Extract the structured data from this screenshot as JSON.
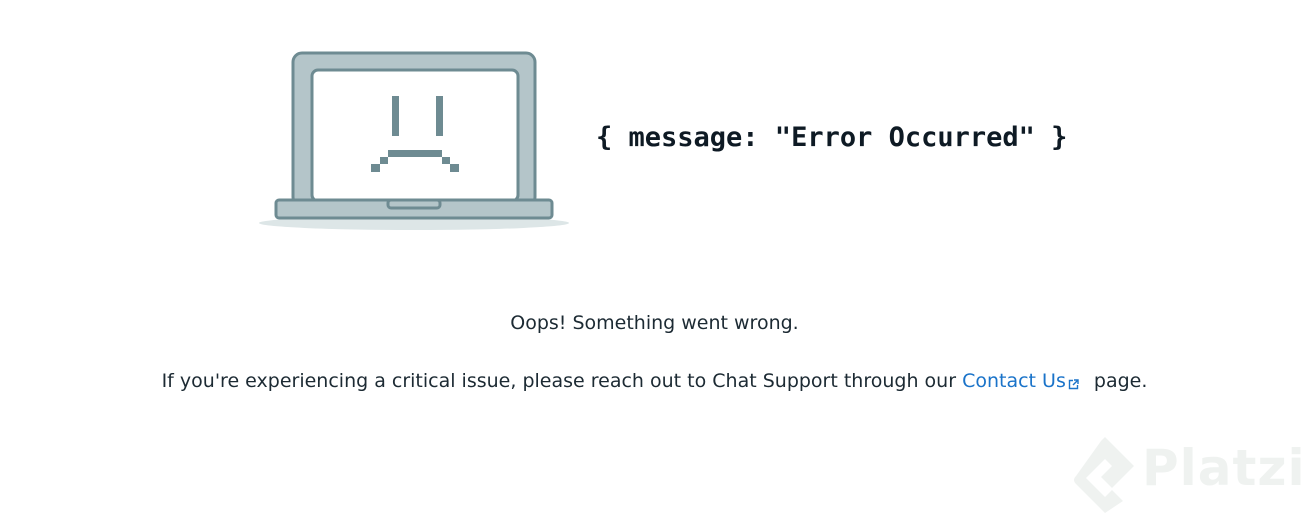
{
  "illustration": {
    "icon": "sad-laptop-icon"
  },
  "error_code_message": "{ message: \"Error Occurred\" }",
  "oops_text": "Oops! Something went wrong.",
  "support": {
    "before_link": "If you're experiencing a critical issue, please reach out to Chat Support through our ",
    "link_label": "Contact Us",
    "link_icon": "external-link-icon",
    "after_link": " page."
  },
  "watermark": {
    "brand": "Platzi",
    "icon": "platzi-logo-icon"
  },
  "colors": {
    "link": "#1a73c9",
    "laptop_frame": "#b4c5c9",
    "laptop_outline": "#6e8b92",
    "text": "#1c2a33",
    "watermark": "#eef1ef"
  }
}
